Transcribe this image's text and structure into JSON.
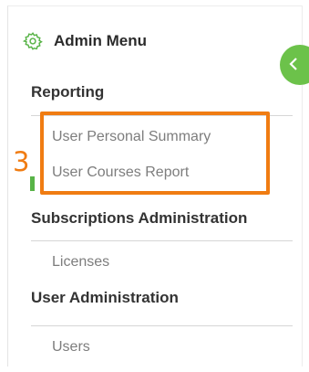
{
  "menu": {
    "title": "Admin Menu",
    "icon": "gear-icon",
    "accent_color": "#58b347",
    "toggle_icon": "chevron-left-icon",
    "sections": [
      {
        "heading": "Reporting",
        "items": [
          "User Personal Summary",
          "User Courses Report"
        ]
      },
      {
        "heading": "Subscriptions Administration",
        "items": [
          "Licenses"
        ]
      },
      {
        "heading": "User Administration",
        "items": [
          "Users"
        ]
      }
    ]
  },
  "annotation": {
    "number": "3",
    "color": "#f07c12"
  }
}
